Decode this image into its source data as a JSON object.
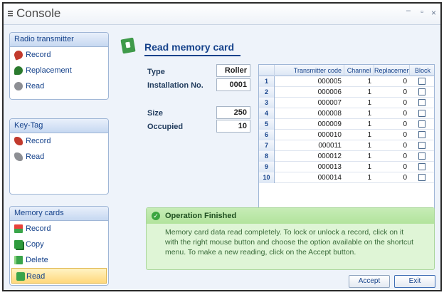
{
  "window": {
    "title": "Console"
  },
  "sidebar": {
    "radio": {
      "header": "Radio transmitter",
      "items": [
        {
          "label": "Record",
          "icon": "radio-record-icon"
        },
        {
          "label": "Replacement",
          "icon": "radio-replacement-icon"
        },
        {
          "label": "Read",
          "icon": "radio-read-icon"
        }
      ]
    },
    "keytag": {
      "header": "Key-Tag",
      "items": [
        {
          "label": "Record",
          "icon": "keytag-record-icon"
        },
        {
          "label": "Read",
          "icon": "keytag-read-icon"
        }
      ]
    },
    "cards": {
      "header": "Memory cards",
      "selected": "Read",
      "items": [
        {
          "label": "Record",
          "icon": "card-record-icon"
        },
        {
          "label": "Copy",
          "icon": "card-copy-icon"
        },
        {
          "label": "Delete",
          "icon": "card-delete-icon"
        },
        {
          "label": "Read",
          "icon": "card-read-icon"
        }
      ]
    }
  },
  "main": {
    "title": "Read memory card",
    "fields": {
      "type_label": "Type",
      "type_value": "Roller",
      "installation_label": "Installation No.",
      "installation_value": "0001",
      "size_label": "Size",
      "size_value": "250",
      "occupied_label": "Occupied",
      "occupied_value": "10"
    },
    "table": {
      "columns": [
        "Transmitter code",
        "Channel",
        "Replacemen",
        "Block"
      ],
      "rows": [
        {
          "num": "1",
          "code": "000005",
          "channel": "1",
          "replacement": "0",
          "block": false
        },
        {
          "num": "2",
          "code": "000006",
          "channel": "1",
          "replacement": "0",
          "block": false
        },
        {
          "num": "3",
          "code": "000007",
          "channel": "1",
          "replacement": "0",
          "block": false
        },
        {
          "num": "4",
          "code": "000008",
          "channel": "1",
          "replacement": "0",
          "block": false
        },
        {
          "num": "5",
          "code": "000009",
          "channel": "1",
          "replacement": "0",
          "block": false
        },
        {
          "num": "6",
          "code": "000010",
          "channel": "1",
          "replacement": "0",
          "block": false
        },
        {
          "num": "7",
          "code": "000011",
          "channel": "1",
          "replacement": "0",
          "block": false
        },
        {
          "num": "8",
          "code": "000012",
          "channel": "1",
          "replacement": "0",
          "block": false
        },
        {
          "num": "9",
          "code": "000013",
          "channel": "1",
          "replacement": "0",
          "block": false
        },
        {
          "num": "10",
          "code": "000014",
          "channel": "1",
          "replacement": "0",
          "block": false
        }
      ]
    },
    "message": {
      "title": "Operation Finished",
      "body": "Memory card data read completely. To lock or unlock a record, click on it with the right mouse button and choose the option available on the shortcut menu. To make a new reading, click on the Accept button."
    },
    "buttons": {
      "accept": "Accept",
      "exit": "Exit"
    }
  }
}
